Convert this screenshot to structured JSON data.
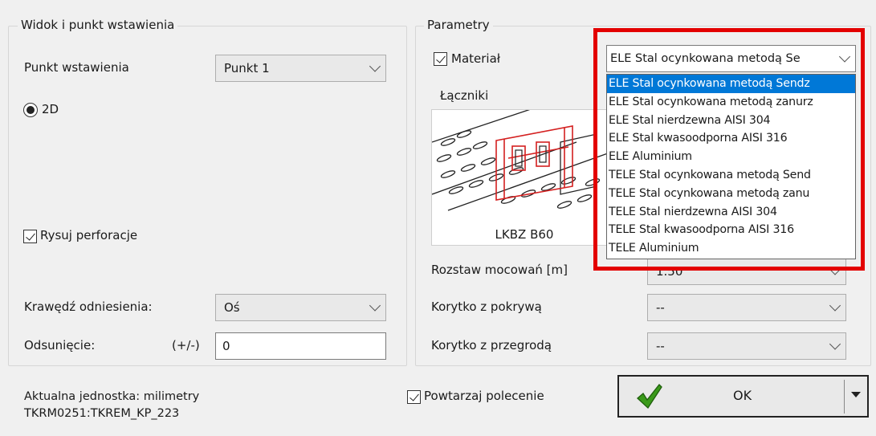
{
  "left_group": {
    "title": "Widok i punkt wstawienia",
    "insert_point_label": "Punkt wstawienia",
    "insert_point_value": "Punkt 1",
    "radio_2d_label": "2D",
    "perforation_label": "Rysuj perforacje",
    "reference_edge_label": "Krawędź odniesienia:",
    "reference_edge_value": "Oś",
    "offset_label": "Odsunięcie:",
    "offset_sign": "(+/-)",
    "offset_value": "0"
  },
  "right_group": {
    "title": "Parametry",
    "material_label": "Materiał",
    "material_value": "ELE Stal ocynkowana metodą Se",
    "connectors_label": "Łączniki",
    "connector_name": "LKBZ B60",
    "spacing_label": "Rozstaw mocowań [m]",
    "spacing_value": "1.50",
    "cover_label": "Korytko z pokrywą",
    "cover_value": "--",
    "divider_label": "Korytko z przegrodą",
    "divider_value": "--"
  },
  "material_dropdown": {
    "items": [
      "ELE Stal ocynkowana metodą Sendz",
      "ELE Stal ocynkowana metodą zanurz",
      "ELE Stal nierdzewna AISI 304",
      "ELE Stal kwasoodporna AISI 316",
      "ELE Aluminium",
      "TELE Stal ocynkowana metodą Send",
      "TELE Stal ocynkowana metodą zanu",
      "TELE Stal nierdzewna AISI 304",
      "TELE Stal kwasoodporna AISI 316",
      "TELE Aluminium"
    ],
    "selected_index": 0
  },
  "footer": {
    "unit_text": "Aktualna jednostka: milimetry",
    "code_text": "TKRM0251:TKREM_KP_223",
    "repeat_label": "Powtarzaj polecenie",
    "ok_label": "OK"
  },
  "colors": {
    "highlight": "#e30000",
    "selection": "#0078d7",
    "checkmark_green": "#3a9a1a",
    "drawing_red": "#d42020"
  }
}
